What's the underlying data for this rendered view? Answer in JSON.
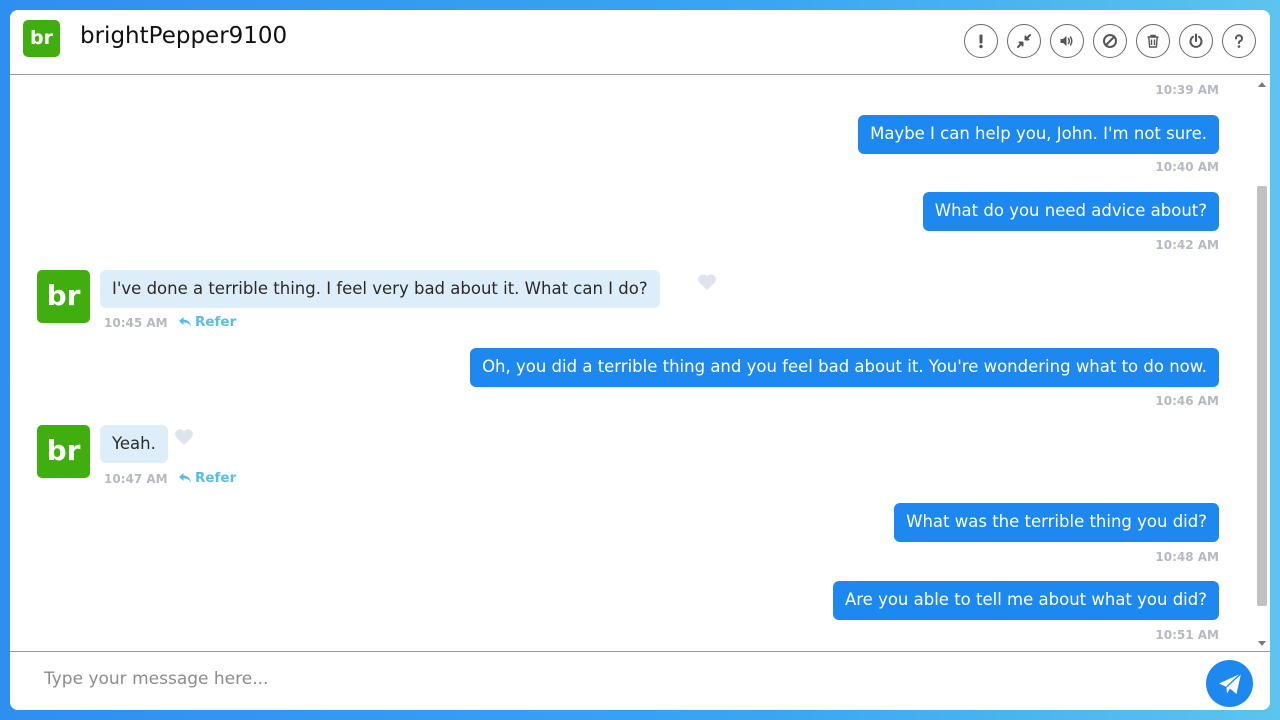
{
  "header": {
    "avatar_initials": "br",
    "username": "brightPepper9100",
    "buttons": [
      {
        "name": "report-button",
        "icon": "exclamation-icon"
      },
      {
        "name": "minimize-button",
        "icon": "compress-icon"
      },
      {
        "name": "sound-button",
        "icon": "volume-icon"
      },
      {
        "name": "block-button",
        "icon": "ban-icon"
      },
      {
        "name": "delete-button",
        "icon": "trash-icon"
      },
      {
        "name": "end-chat-button",
        "icon": "power-icon"
      },
      {
        "name": "help-button",
        "icon": "question-icon"
      }
    ]
  },
  "messages": {
    "top_time": "10:39 AM",
    "m1": {
      "text": "Maybe I can help you, John. I'm not sure.",
      "time": "10:40 AM"
    },
    "m2": {
      "text": "What do you need advice about?",
      "time": "10:42 AM"
    },
    "m3": {
      "avatar": "br",
      "text": "I've done a terrible thing. I feel very bad about it. What can I do?",
      "time": "10:45 AM",
      "refer": "Refer"
    },
    "m4": {
      "text": "Oh, you did a terrible thing and you feel bad about it. You're wondering what to do now.",
      "time": "10:46 AM"
    },
    "m5": {
      "avatar": "br",
      "text": "Yeah.",
      "time": "10:47 AM",
      "refer": "Refer"
    },
    "m6": {
      "text": "What was the terrible thing you did?",
      "time": "10:48 AM"
    },
    "m7": {
      "text": "Are you able to tell me about what you did?",
      "time": "10:51 AM"
    }
  },
  "composer": {
    "placeholder": "Type your message here...",
    "value": ""
  },
  "colors": {
    "accent": "#1e88f1",
    "avatar": "#3fae0e",
    "incoming_bubble": "#ddeefa",
    "refer": "#5bbde0"
  }
}
